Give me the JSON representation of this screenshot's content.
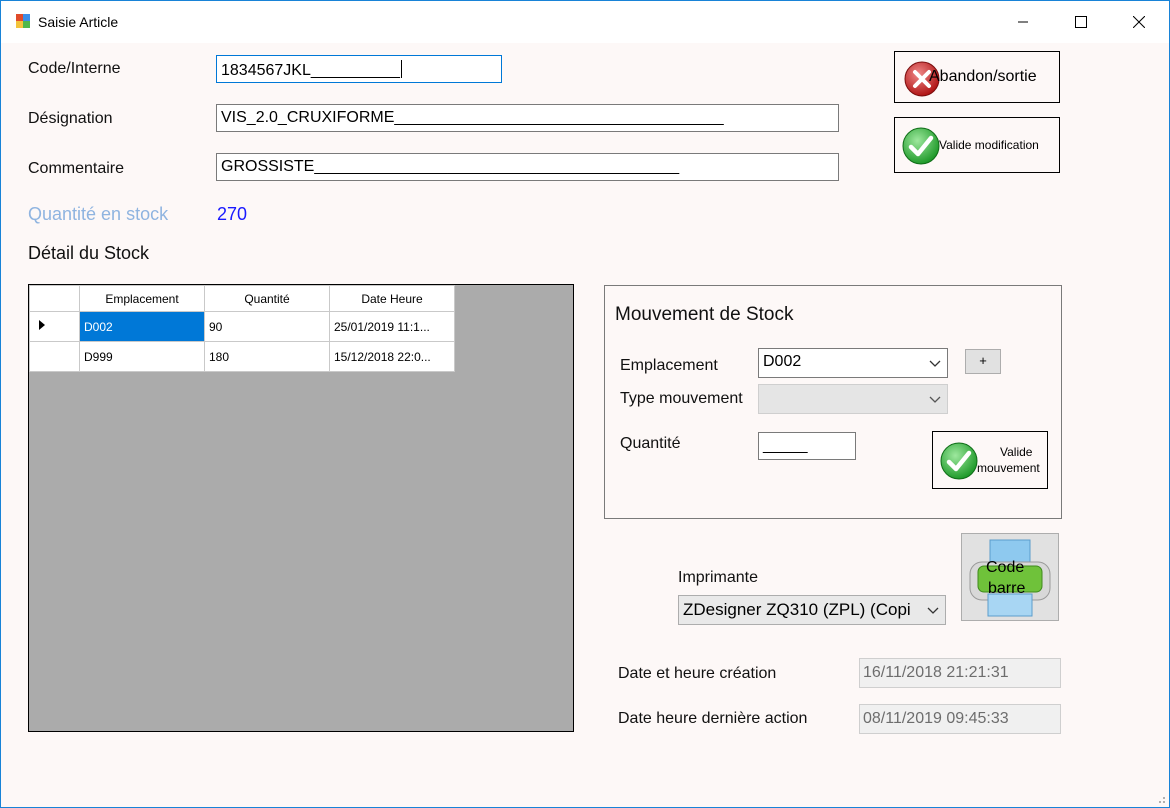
{
  "window": {
    "title": "Saisie Article"
  },
  "form": {
    "code_label": "Code/Interne",
    "code_value": "1834567JKL__________",
    "designation_label": "Désignation",
    "designation_value": "VIS_2.0_CRUXIFORME_____________________________________",
    "comment_label": "Commentaire",
    "comment_value": "GROSSISTE_________________________________________",
    "stock_qty_label": "Quantité en stock",
    "stock_qty_value": "270",
    "stock_detail_label": "Détail du Stock"
  },
  "buttons": {
    "abandon_label": "Abandon/sortie",
    "validate_edit_label": "Valide modification",
    "validate_move_line1": "Valide",
    "validate_move_line2": "mouvement",
    "add_label": "+",
    "barcode_line1": "Code",
    "barcode_line2": "barre"
  },
  "grid": {
    "columns": [
      "Emplacement",
      "Quantité",
      "Date Heure"
    ],
    "rows": [
      {
        "location": "D002",
        "qty": "90",
        "datetime": "25/01/2019 11:1..."
      },
      {
        "location": "D999",
        "qty": "180",
        "datetime": "15/12/2018 22:0..."
      }
    ]
  },
  "movement": {
    "group_title": "Mouvement de Stock",
    "location_label": "Emplacement",
    "location_value": "D002",
    "type_label": "Type mouvement",
    "type_value": "",
    "qty_label": "Quantité",
    "qty_value": "_____"
  },
  "printer": {
    "label": "Imprimante",
    "value": "ZDesigner ZQ310 (ZPL) (Copi"
  },
  "dates": {
    "created_label": "Date et heure création",
    "created_value": "16/11/2018 21:21:31",
    "last_action_label": "Date heure dernière action",
    "last_action_value": "08/11/2019 09:45:33"
  },
  "colors": {
    "accent": "#0078d7",
    "stock_label": "#8fb4e0",
    "stock_value": "#1a1aff",
    "grid_bg": "#ababab"
  }
}
